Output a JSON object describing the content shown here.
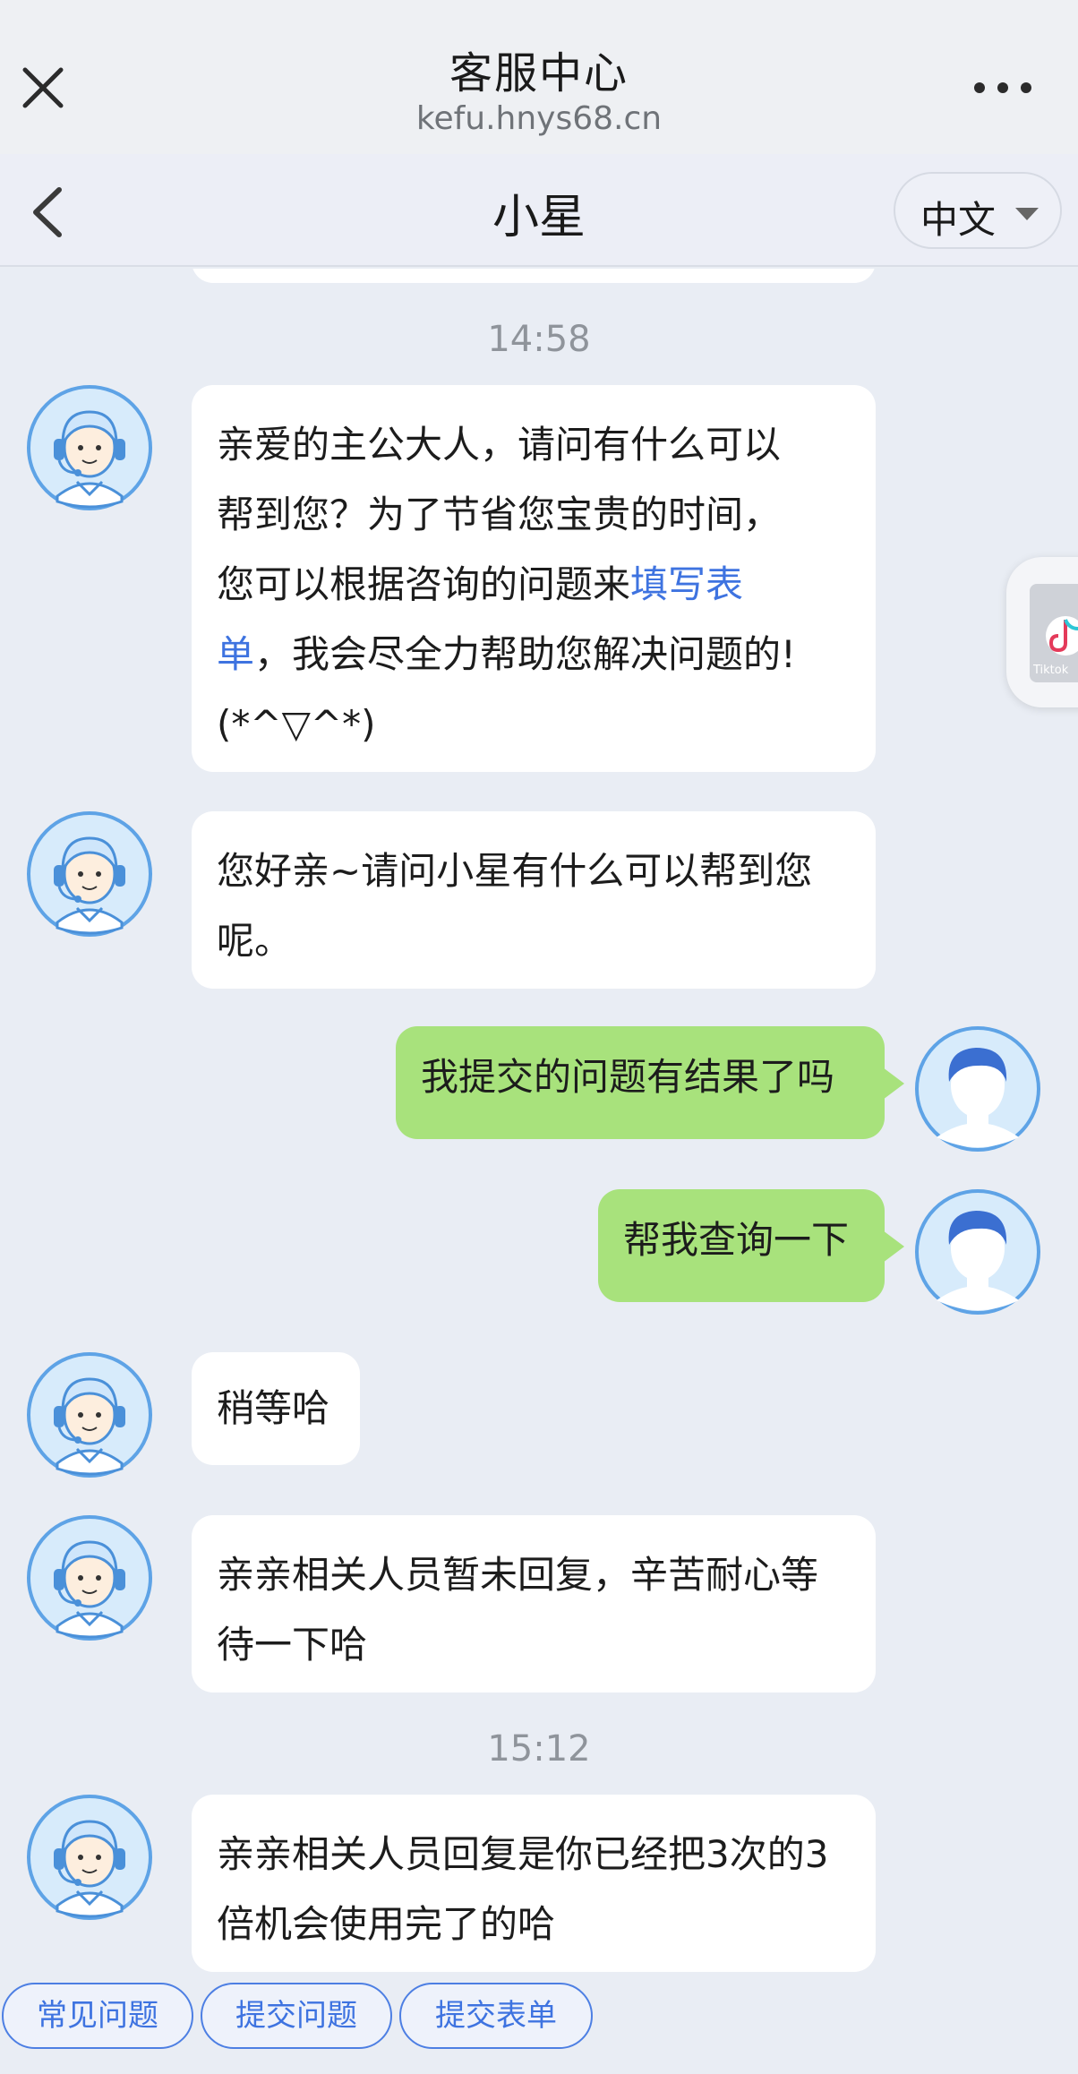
{
  "browser": {
    "title": "客服中心",
    "url": "kefu.hnys68.cn"
  },
  "header": {
    "title": "小星",
    "language": "中文"
  },
  "messages": [
    {
      "type": "time",
      "text": "14:58"
    },
    {
      "type": "agent",
      "parts": [
        "亲爱的主公大人，请问有什么可以",
        "帮到您？为了节省您宝贵的时间，",
        "您可以根据咨询的问题来",
        "填写表",
        "单",
        "，我会尽全力帮助您解决问题的!",
        "(*^▽^*)"
      ]
    },
    {
      "type": "agent",
      "text": "您好亲~请问小星有什么可以帮到您呢。"
    },
    {
      "type": "user",
      "text": "我提交的问题有结果了吗"
    },
    {
      "type": "user",
      "text": "帮我查询一下"
    },
    {
      "type": "agent",
      "text": "稍等哈"
    },
    {
      "type": "agent",
      "text": "亲亲相关人员暂未回复，辛苦耐心等待一下哈"
    },
    {
      "type": "time",
      "text": "15:12"
    },
    {
      "type": "agent",
      "text": "亲亲相关人员回复是你已经把3次的3倍机会使用完了的哈"
    }
  ],
  "float_widget": {
    "label": "Tiktok",
    "icon": "tiktok-icon"
  },
  "quick_actions": [
    "常见问题",
    "提交问题",
    "提交表单"
  ],
  "colors": {
    "background": "#e9edf4",
    "user_bubble": "#a8e27c",
    "agent_bubble": "#ffffff",
    "link": "#3e73e0"
  }
}
